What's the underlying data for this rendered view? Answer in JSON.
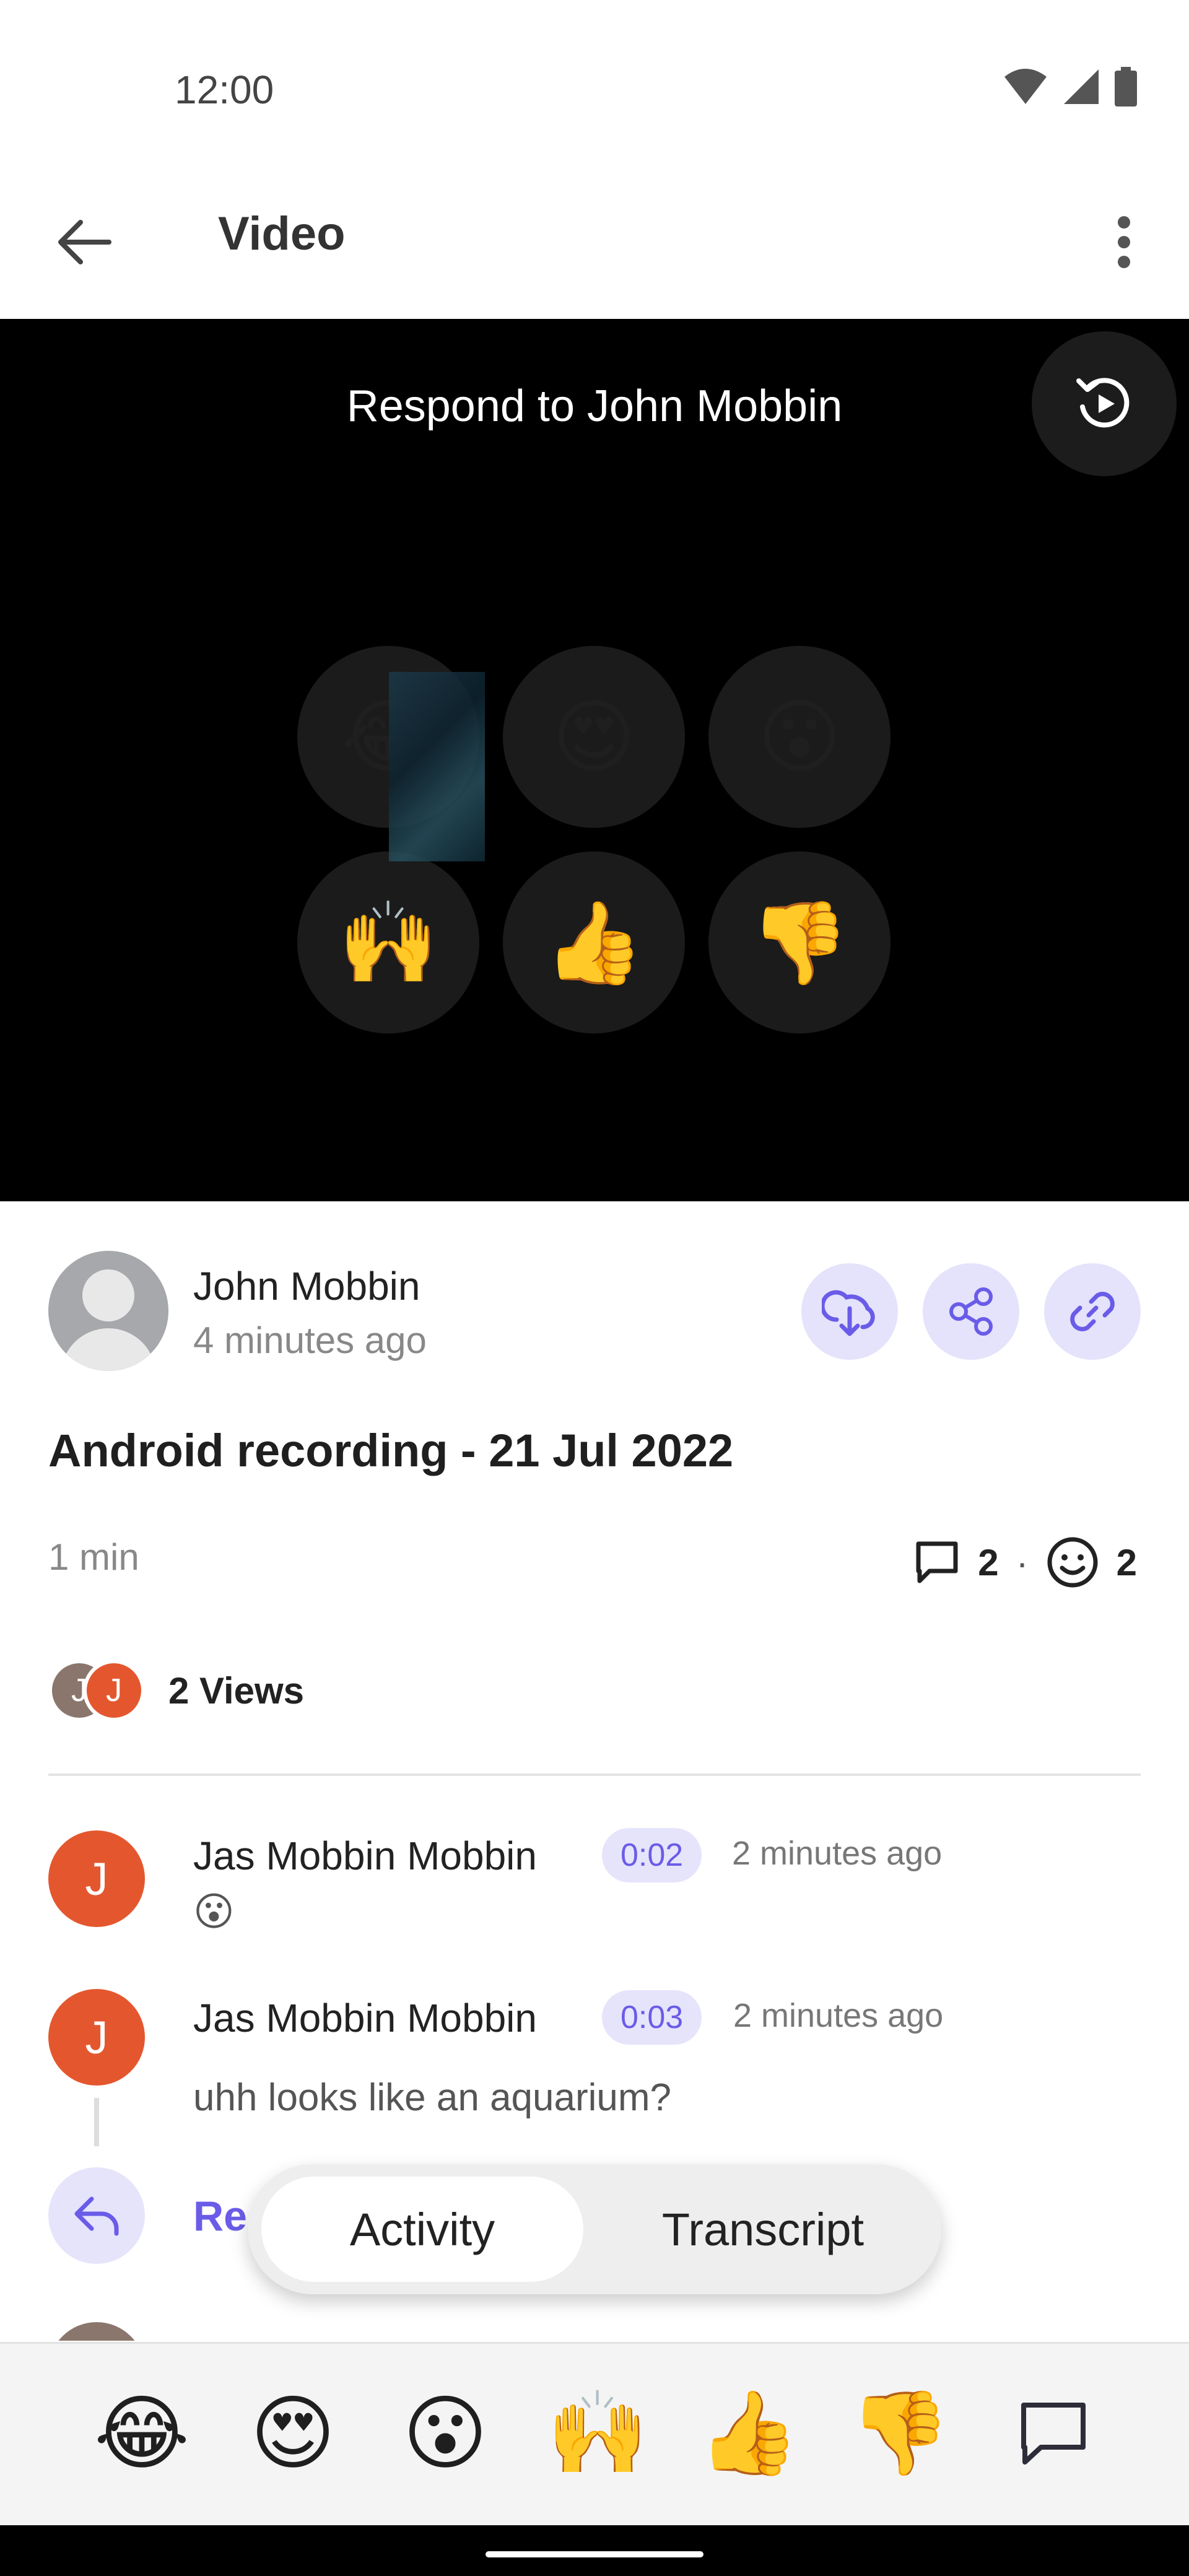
{
  "status_bar": {
    "time": "12:00"
  },
  "app_bar": {
    "title": "Video"
  },
  "video": {
    "prompt": "Respond to John Mobbin",
    "reactions": [
      "😂",
      "😍",
      "😮",
      "🙌",
      "👍",
      "👎"
    ]
  },
  "author": {
    "name": "John Mobbin",
    "time": "4 minutes ago"
  },
  "video_title": "Android recording - 21 Jul 2022",
  "duration": "1 min",
  "stats": {
    "comments": "2",
    "separator": "·",
    "reactions": "2"
  },
  "viewers": {
    "avatars": [
      "J",
      "J"
    ],
    "label": "2 Views"
  },
  "comments": [
    {
      "initial": "J",
      "name": "Jas Mobbin Mobbin",
      "stamp": "0:02",
      "time": "2 minutes ago",
      "body": "😮"
    },
    {
      "initial": "J",
      "name": "Jas Mobbin Mobbin",
      "stamp": "0:03",
      "time": "2 minutes ago",
      "body": "uhh looks like an aquarium?"
    }
  ],
  "reply": {
    "label": "Re"
  },
  "tabs": {
    "active": "Activity",
    "inactive": "Transcript"
  },
  "bottom_reactions": [
    "😂",
    "😍",
    "😮",
    "🙌",
    "👍",
    "👎"
  ],
  "colors": {
    "accent": "#6a5ce8",
    "accent_bg": "#e4e3fb",
    "avatar_orange": "#e4572e"
  },
  "icons": {
    "back": "arrow-left-icon",
    "more": "more-vert-icon",
    "replay": "replay-icon",
    "download": "download-icon",
    "share": "share-icon",
    "link": "link-icon",
    "comment": "comment-icon",
    "emoji": "smiley-icon",
    "reply": "reply-icon"
  }
}
